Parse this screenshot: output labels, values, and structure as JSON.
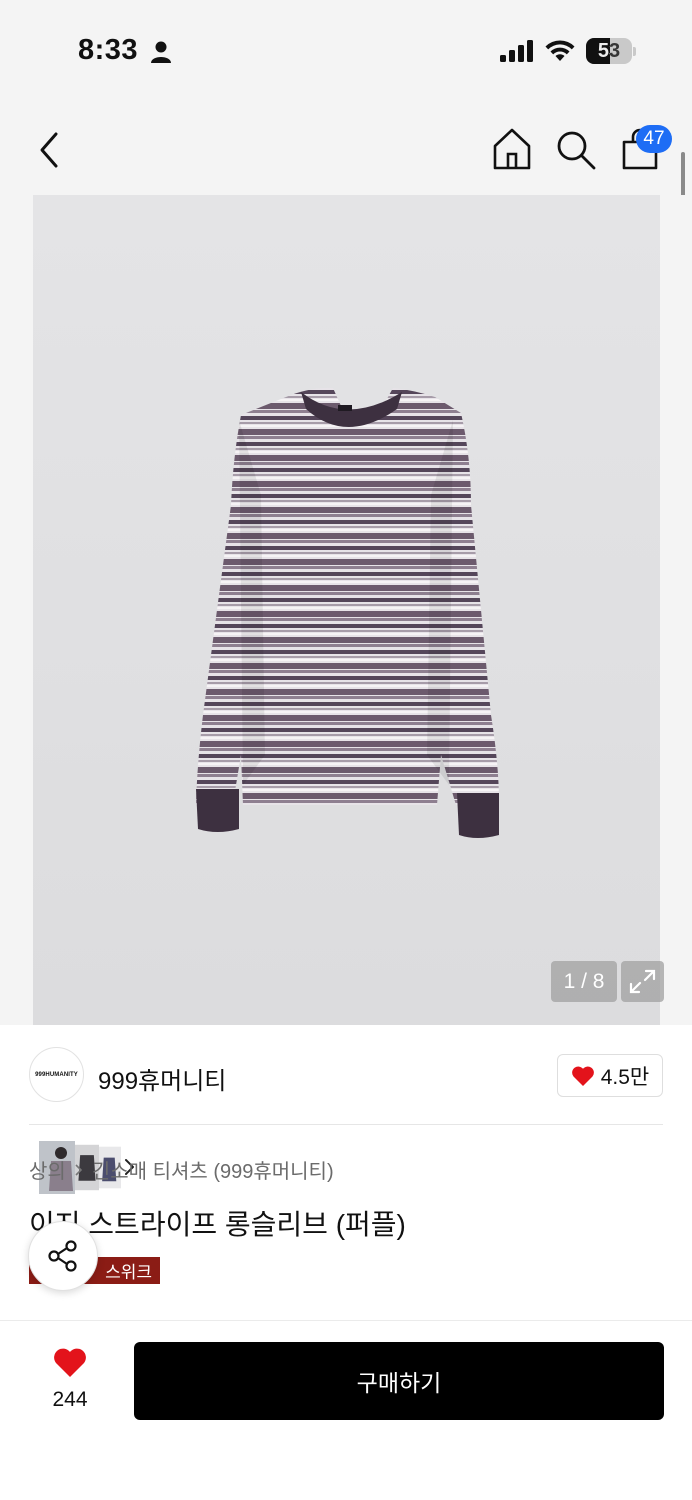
{
  "status_bar": {
    "time": "8:33",
    "battery_level": "53"
  },
  "nav": {
    "cart_count": "47"
  },
  "gallery": {
    "page_counter": "1 / 8"
  },
  "brand": {
    "logo_text": "999HUMANITY",
    "name": "999휴머니티",
    "like_count": "4.5만"
  },
  "breadcrumb": {
    "category": "상의",
    "subcategory": "긴소매 티셔츠 (999휴머니티)"
  },
  "product": {
    "title": "이지 스트라이프 롱슬리브 (퍼플)",
    "tag": "스위크"
  },
  "bottom_bar": {
    "wish_count": "244",
    "buy_label": "구매하기"
  },
  "colors": {
    "accent_blue": "#1e6df5",
    "heart_red": "#e3131b",
    "tag_red": "#8b1c15"
  },
  "icons": [
    "person-icon",
    "signal-icon",
    "wifi-icon",
    "battery-icon",
    "back-arrow-icon",
    "home-icon",
    "search-icon",
    "shopping-bag-icon",
    "chevron-right-icon",
    "expand-icon",
    "heart-icon",
    "share-icon"
  ]
}
